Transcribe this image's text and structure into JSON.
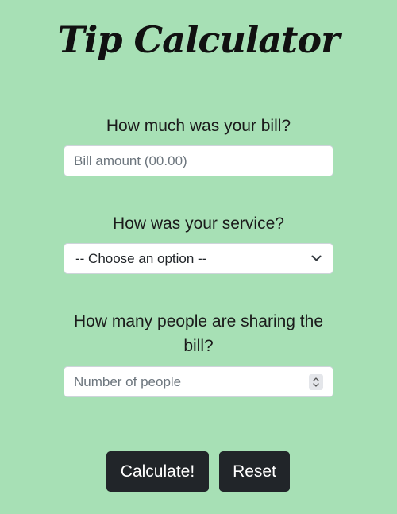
{
  "page": {
    "title": "Tip Calculator"
  },
  "form": {
    "bill": {
      "question": "How much was your bill?",
      "placeholder": "Bill amount (00.00)",
      "value": ""
    },
    "service": {
      "question": "How was your service?",
      "selected": "-- Choose an option --",
      "icon": "chevron-down-icon"
    },
    "people": {
      "question": "How many people are sharing the bill?",
      "placeholder": "Number of people",
      "value": "",
      "icon": "spinner-arrows-icon"
    }
  },
  "actions": {
    "calculate_label": "Calculate!",
    "reset_label": "Reset"
  },
  "colors": {
    "background": "#a7e0b5",
    "button": "#212529",
    "button_text": "#ffffff"
  }
}
